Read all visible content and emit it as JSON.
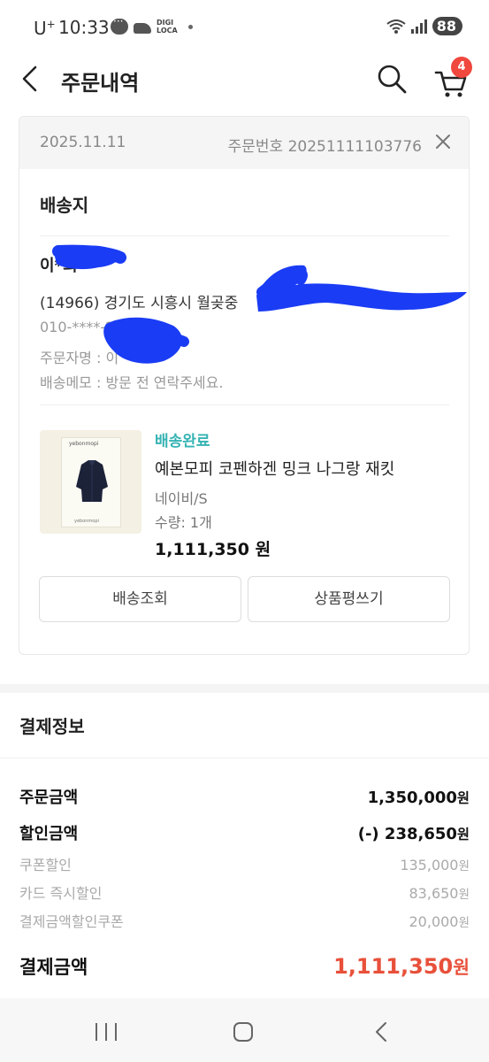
{
  "status_bar": {
    "carrier": "U",
    "carrier_sup": "+",
    "time": "10:33",
    "digi_top": "DIGI",
    "digi_bottom": "LOCA",
    "battery": "88"
  },
  "header": {
    "title": "주문내역",
    "cart_count": "4"
  },
  "order": {
    "date": "2025.11.11",
    "order_number": "주문번호 20251111103776",
    "shipping_title": "배송지",
    "recipient_name": "이*희",
    "address": "(14966) 경기도 시흥시 월곶중",
    "phone": "010-****-2",
    "orderer": "주문자명 : 이",
    "memo": "배송메모 : 방문 전 연락주세요.",
    "product": {
      "status": "배송완료",
      "name": "예본모피 코펜하겐 밍크 나그랑 재킷",
      "option": "네이비/S",
      "quantity": "수량: 1개",
      "price": "1,111,350 원",
      "thumb_brand": "yebonmopi",
      "thumb_footer": "yebonmopi"
    },
    "buttons": {
      "track": "배송조회",
      "review": "상품평쓰기"
    }
  },
  "payment": {
    "title": "결제정보",
    "order_amount_label": "주문금액",
    "order_amount": "1,350,000",
    "discount_label": "할인금액",
    "discount": "(-) 238,650",
    "coupon_label": "쿠폰할인",
    "coupon": "135,000",
    "card_label": "카드 즉시할인",
    "card": "83,650",
    "pay_coupon_label": "결제금액할인쿠폰",
    "pay_coupon": "20,000",
    "total_label": "결제금액",
    "total": "1,111,350",
    "currency": "원"
  },
  "colors": {
    "accent_status": "#35b3b3",
    "total_price": "#e8503a",
    "badge": "#f0473e",
    "redaction": "#1a3cf5"
  }
}
